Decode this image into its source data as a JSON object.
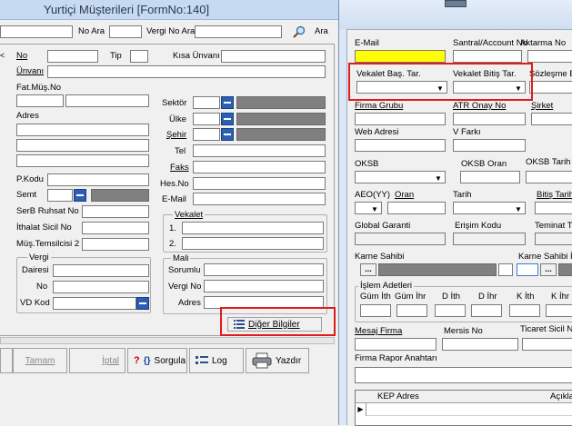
{
  "main_window": {
    "title": "Yurtiçi Müşterileri [FormNo:140]",
    "top_bar": {
      "no_ara": "No Ara",
      "vergi_no_ara": "Vergi No Ara",
      "ara": "Ara"
    },
    "left": {
      "no": "No",
      "tip": "Tip",
      "kisa_unvani": "Kısa Ünvanı",
      "unvani": "Ünvanı",
      "fat_mus_no": "Fat.Müş.No",
      "adres": "Adres",
      "p_kodu": "P.Kodu",
      "semt": "Semt",
      "serb_ruhsat_no": "SerB Ruhsat No",
      "ithalat_sicil_no": "İthalat Sicil No",
      "mus_temsilcisi_2": "Müş.Temsilcisi 2",
      "vergi_caption": "Vergi",
      "dairesi": "Dairesi",
      "no2": "No",
      "vd_kod": "VD Kod"
    },
    "right": {
      "sektor": "Sektör",
      "ulke": "Ülke",
      "sehir": "Şehir",
      "tel": "Tel",
      "faks": "Faks",
      "hes_no": "Hes.No",
      "e_mail": "E-Mail",
      "vekalet_caption": "Vekalet",
      "vekalet_1": "1.",
      "vekalet_2": "2.",
      "mali_caption": "Mali",
      "sorumlu": "Sorumlu",
      "vergi_no": "Vergi No",
      "adres": "Adres",
      "diger_bilgiler": "Diğer Bilgiler"
    },
    "bottom_buttons": {
      "tamam": "Tamam",
      "iptal": "İptal",
      "sorgula": "Sorgula",
      "log": "Log",
      "yazdir": "Yazdır"
    }
  },
  "popup": {
    "e_mail": "E-Mail",
    "santral": "Santral/Account No",
    "aktarma": "Aktarma No",
    "vekalet_bas_tar": "Vekalet Baş. Tar.",
    "vekalet_bitis_tar": "Vekalet Bitiş Tar.",
    "sozlesme": "Sözleşme B",
    "firma_grubu": "Firma Grubu",
    "atr_onay_no": "ATR Onay No",
    "sirket": "Şirket",
    "web_adresi": "Web Adresi",
    "v_farki": "V Farkı",
    "oksb": "OKSB",
    "oksb_oran": "OKSB Oran",
    "oksb_tarih": "OKSB Tarih",
    "aeo_yy": "AEO(YY)",
    "oran": "Oran",
    "tarih": "Tarih",
    "bitis_tarihi": "Bitiş Tarihi",
    "global_garanti": "Global Garanti",
    "erisim_kodu": "Erişim Kodu",
    "teminat_tu": "Teminat Tu",
    "karne_sahibi": "Karne Sahibi",
    "karne_sahibi_il": "Karne Sahibi İl",
    "islem_adetleri": "İşlem Adetleri",
    "gum_ith": "Güm İth",
    "gum_ihr": "Güm İhr",
    "d_ith": "D İth",
    "d_ihr": "D İhr",
    "k_ith": "K İth",
    "k_ihr": "K İhr",
    "mesaj_firma": "Mesaj Firma",
    "mersis_no": "Mersis No",
    "ticaret_sicil_no": "Ticaret Sicil No",
    "firma_rapor_anahtari": "Firma Rapor Anahtarı",
    "kep_adres": "KEP Adres",
    "aciklama": "Açıklama"
  }
}
